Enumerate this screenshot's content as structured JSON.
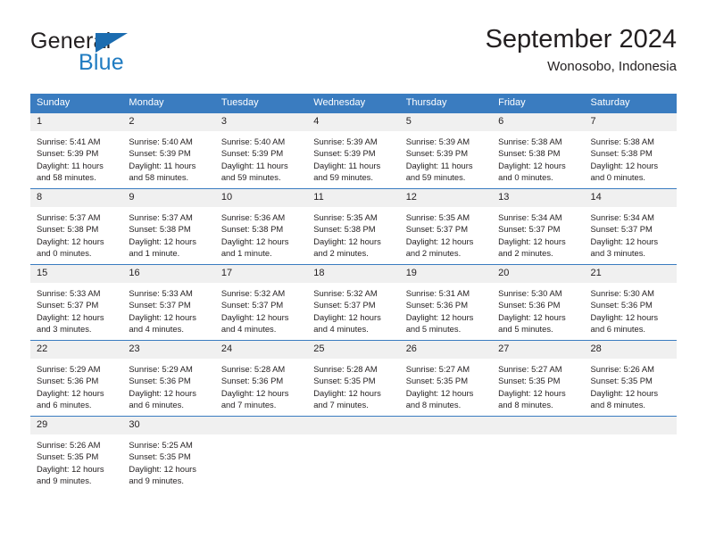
{
  "brand": {
    "name_part1": "General",
    "name_part2": "Blue",
    "flag_icon": "triangle-flag-icon"
  },
  "header": {
    "title": "September 2024",
    "subtitle": "Wonosobo, Indonesia"
  },
  "colors": {
    "header_blue": "#3a7cc0",
    "brand_blue": "#1f7bc1",
    "daynum_bg": "#f0f0f0",
    "text": "#231f20"
  },
  "weekdays": [
    "Sunday",
    "Monday",
    "Tuesday",
    "Wednesday",
    "Thursday",
    "Friday",
    "Saturday"
  ],
  "weeks": [
    [
      {
        "day": "1",
        "sunrise": "Sunrise: 5:41 AM",
        "sunset": "Sunset: 5:39 PM",
        "daylight1": "Daylight: 11 hours",
        "daylight2": "and 58 minutes."
      },
      {
        "day": "2",
        "sunrise": "Sunrise: 5:40 AM",
        "sunset": "Sunset: 5:39 PM",
        "daylight1": "Daylight: 11 hours",
        "daylight2": "and 58 minutes."
      },
      {
        "day": "3",
        "sunrise": "Sunrise: 5:40 AM",
        "sunset": "Sunset: 5:39 PM",
        "daylight1": "Daylight: 11 hours",
        "daylight2": "and 59 minutes."
      },
      {
        "day": "4",
        "sunrise": "Sunrise: 5:39 AM",
        "sunset": "Sunset: 5:39 PM",
        "daylight1": "Daylight: 11 hours",
        "daylight2": "and 59 minutes."
      },
      {
        "day": "5",
        "sunrise": "Sunrise: 5:39 AM",
        "sunset": "Sunset: 5:39 PM",
        "daylight1": "Daylight: 11 hours",
        "daylight2": "and 59 minutes."
      },
      {
        "day": "6",
        "sunrise": "Sunrise: 5:38 AM",
        "sunset": "Sunset: 5:38 PM",
        "daylight1": "Daylight: 12 hours",
        "daylight2": "and 0 minutes."
      },
      {
        "day": "7",
        "sunrise": "Sunrise: 5:38 AM",
        "sunset": "Sunset: 5:38 PM",
        "daylight1": "Daylight: 12 hours",
        "daylight2": "and 0 minutes."
      }
    ],
    [
      {
        "day": "8",
        "sunrise": "Sunrise: 5:37 AM",
        "sunset": "Sunset: 5:38 PM",
        "daylight1": "Daylight: 12 hours",
        "daylight2": "and 0 minutes."
      },
      {
        "day": "9",
        "sunrise": "Sunrise: 5:37 AM",
        "sunset": "Sunset: 5:38 PM",
        "daylight1": "Daylight: 12 hours",
        "daylight2": "and 1 minute."
      },
      {
        "day": "10",
        "sunrise": "Sunrise: 5:36 AM",
        "sunset": "Sunset: 5:38 PM",
        "daylight1": "Daylight: 12 hours",
        "daylight2": "and 1 minute."
      },
      {
        "day": "11",
        "sunrise": "Sunrise: 5:35 AM",
        "sunset": "Sunset: 5:38 PM",
        "daylight1": "Daylight: 12 hours",
        "daylight2": "and 2 minutes."
      },
      {
        "day": "12",
        "sunrise": "Sunrise: 5:35 AM",
        "sunset": "Sunset: 5:37 PM",
        "daylight1": "Daylight: 12 hours",
        "daylight2": "and 2 minutes."
      },
      {
        "day": "13",
        "sunrise": "Sunrise: 5:34 AM",
        "sunset": "Sunset: 5:37 PM",
        "daylight1": "Daylight: 12 hours",
        "daylight2": "and 2 minutes."
      },
      {
        "day": "14",
        "sunrise": "Sunrise: 5:34 AM",
        "sunset": "Sunset: 5:37 PM",
        "daylight1": "Daylight: 12 hours",
        "daylight2": "and 3 minutes."
      }
    ],
    [
      {
        "day": "15",
        "sunrise": "Sunrise: 5:33 AM",
        "sunset": "Sunset: 5:37 PM",
        "daylight1": "Daylight: 12 hours",
        "daylight2": "and 3 minutes."
      },
      {
        "day": "16",
        "sunrise": "Sunrise: 5:33 AM",
        "sunset": "Sunset: 5:37 PM",
        "daylight1": "Daylight: 12 hours",
        "daylight2": "and 4 minutes."
      },
      {
        "day": "17",
        "sunrise": "Sunrise: 5:32 AM",
        "sunset": "Sunset: 5:37 PM",
        "daylight1": "Daylight: 12 hours",
        "daylight2": "and 4 minutes."
      },
      {
        "day": "18",
        "sunrise": "Sunrise: 5:32 AM",
        "sunset": "Sunset: 5:37 PM",
        "daylight1": "Daylight: 12 hours",
        "daylight2": "and 4 minutes."
      },
      {
        "day": "19",
        "sunrise": "Sunrise: 5:31 AM",
        "sunset": "Sunset: 5:36 PM",
        "daylight1": "Daylight: 12 hours",
        "daylight2": "and 5 minutes."
      },
      {
        "day": "20",
        "sunrise": "Sunrise: 5:30 AM",
        "sunset": "Sunset: 5:36 PM",
        "daylight1": "Daylight: 12 hours",
        "daylight2": "and 5 minutes."
      },
      {
        "day": "21",
        "sunrise": "Sunrise: 5:30 AM",
        "sunset": "Sunset: 5:36 PM",
        "daylight1": "Daylight: 12 hours",
        "daylight2": "and 6 minutes."
      }
    ],
    [
      {
        "day": "22",
        "sunrise": "Sunrise: 5:29 AM",
        "sunset": "Sunset: 5:36 PM",
        "daylight1": "Daylight: 12 hours",
        "daylight2": "and 6 minutes."
      },
      {
        "day": "23",
        "sunrise": "Sunrise: 5:29 AM",
        "sunset": "Sunset: 5:36 PM",
        "daylight1": "Daylight: 12 hours",
        "daylight2": "and 6 minutes."
      },
      {
        "day": "24",
        "sunrise": "Sunrise: 5:28 AM",
        "sunset": "Sunset: 5:36 PM",
        "daylight1": "Daylight: 12 hours",
        "daylight2": "and 7 minutes."
      },
      {
        "day": "25",
        "sunrise": "Sunrise: 5:28 AM",
        "sunset": "Sunset: 5:35 PM",
        "daylight1": "Daylight: 12 hours",
        "daylight2": "and 7 minutes."
      },
      {
        "day": "26",
        "sunrise": "Sunrise: 5:27 AM",
        "sunset": "Sunset: 5:35 PM",
        "daylight1": "Daylight: 12 hours",
        "daylight2": "and 8 minutes."
      },
      {
        "day": "27",
        "sunrise": "Sunrise: 5:27 AM",
        "sunset": "Sunset: 5:35 PM",
        "daylight1": "Daylight: 12 hours",
        "daylight2": "and 8 minutes."
      },
      {
        "day": "28",
        "sunrise": "Sunrise: 5:26 AM",
        "sunset": "Sunset: 5:35 PM",
        "daylight1": "Daylight: 12 hours",
        "daylight2": "and 8 minutes."
      }
    ],
    [
      {
        "day": "29",
        "sunrise": "Sunrise: 5:26 AM",
        "sunset": "Sunset: 5:35 PM",
        "daylight1": "Daylight: 12 hours",
        "daylight2": "and 9 minutes."
      },
      {
        "day": "30",
        "sunrise": "Sunrise: 5:25 AM",
        "sunset": "Sunset: 5:35 PM",
        "daylight1": "Daylight: 12 hours",
        "daylight2": "and 9 minutes."
      },
      {
        "day": "",
        "sunrise": "",
        "sunset": "",
        "daylight1": "",
        "daylight2": ""
      },
      {
        "day": "",
        "sunrise": "",
        "sunset": "",
        "daylight1": "",
        "daylight2": ""
      },
      {
        "day": "",
        "sunrise": "",
        "sunset": "",
        "daylight1": "",
        "daylight2": ""
      },
      {
        "day": "",
        "sunrise": "",
        "sunset": "",
        "daylight1": "",
        "daylight2": ""
      },
      {
        "day": "",
        "sunrise": "",
        "sunset": "",
        "daylight1": "",
        "daylight2": ""
      }
    ]
  ]
}
